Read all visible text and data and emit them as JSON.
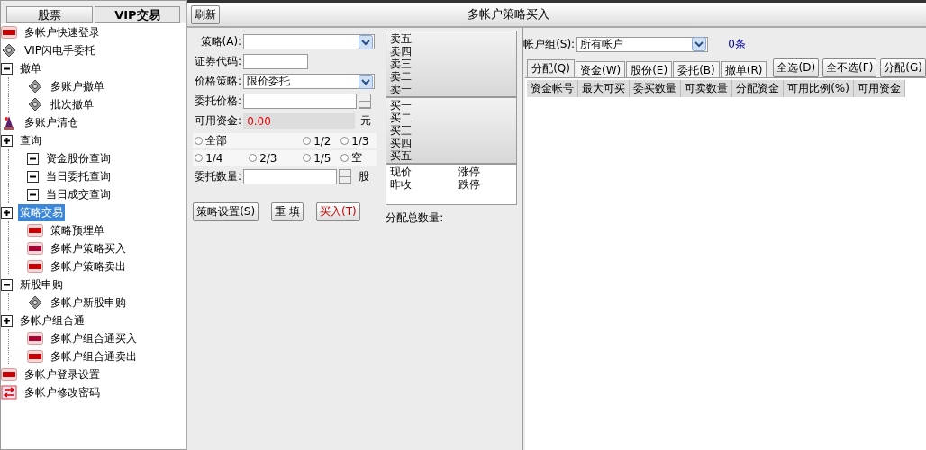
{
  "sidebar": {
    "tabs": [
      {
        "label": "股票",
        "selected": false
      },
      {
        "label": "VIP交易",
        "selected": true
      }
    ],
    "tree": [
      {
        "label": "多帐户快速登录",
        "kind": "sell",
        "selected": false
      },
      {
        "label": "VIP闪电手委托",
        "kind": "gear",
        "selected": false
      },
      {
        "label": "撤单",
        "kind": "minus",
        "selected": false,
        "children": [
          {
            "label": "多账户撤单",
            "kind": "gear",
            "selected": false
          },
          {
            "label": "批次撤单",
            "kind": "gear",
            "selected": false
          }
        ]
      },
      {
        "label": "多账户清仓",
        "kind": "wizard",
        "selected": false
      },
      {
        "label": "查询",
        "kind": "plus",
        "selected": false,
        "children": [
          {
            "label": "资金股份查询",
            "kind": "minus",
            "selected": false
          },
          {
            "label": "当日委托查询",
            "kind": "minus",
            "selected": false
          },
          {
            "label": "当日成交查询",
            "kind": "minus",
            "selected": false
          }
        ]
      },
      {
        "label": "策略交易",
        "kind": "plus",
        "selected": true,
        "children": [
          {
            "label": "策略预埋单",
            "kind": "sell",
            "selected": false
          },
          {
            "label": "多帐户策略买入",
            "kind": "buy",
            "selected": false
          },
          {
            "label": "多帐户策略卖出",
            "kind": "sell",
            "selected": false
          }
        ]
      },
      {
        "label": "新股申购",
        "kind": "minus",
        "selected": false,
        "children": [
          {
            "label": "多帐户新股申购",
            "kind": "gear",
            "selected": false
          }
        ]
      },
      {
        "label": "多帐户组合通",
        "kind": "plus",
        "selected": false,
        "children": [
          {
            "label": "多帐户组合通买入",
            "kind": "buy",
            "selected": false
          },
          {
            "label": "多帐户组合通卖出",
            "kind": "sell",
            "selected": false
          }
        ]
      },
      {
        "label": "多帐户登录设置",
        "kind": "sell",
        "selected": false
      },
      {
        "label": "多帐户修改密码",
        "kind": "swap",
        "selected": false
      }
    ]
  },
  "header": {
    "refresh_button": "刷新",
    "title": "多帐户策略买入"
  },
  "form": {
    "fields": [
      {
        "kind": "select",
        "label": "策略(A):"
      },
      {
        "kind": "text",
        "label": "证券代码:"
      },
      {
        "kind": "select",
        "label": "价格策略:",
        "value": "限价委托"
      },
      {
        "kind": "spin",
        "label": "委托价格:"
      },
      {
        "kind": "readonly",
        "label": "可用资金:",
        "value": "0.00",
        "unit": "元"
      }
    ],
    "ratios": [
      {
        "label": "全部",
        "checked": false
      },
      {
        "label": "1/2",
        "checked": false
      },
      {
        "label": "1/3",
        "checked": false
      },
      {
        "label": "1/4",
        "checked": false
      },
      {
        "label": "2/3",
        "checked": false
      },
      {
        "label": "1/5",
        "checked": false
      },
      {
        "label": "空",
        "checked": false
      }
    ],
    "quantity": {
      "label": "委托数量:",
      "unit": "股"
    },
    "buttons": [
      {
        "label": "策略设置(S)",
        "kind": "normal"
      },
      {
        "label": "重 填",
        "kind": "normal"
      },
      {
        "label": "买入(T)",
        "kind": "buy"
      }
    ]
  },
  "quote": {
    "asks": [
      "卖五",
      "卖四",
      "卖三",
      "卖二",
      "卖一"
    ],
    "bids": [
      "买一",
      "买二",
      "买三",
      "买四",
      "买五"
    ],
    "stats": [
      "现价",
      "涨停",
      "昨收",
      "跌停"
    ],
    "allocation_total_label": "分配总数量:"
  },
  "accounts": {
    "group_label": "帐户组(S):",
    "group_value": "所有帐户",
    "count": "0条",
    "tabs": [
      {
        "label": "分配(Q)",
        "selected": true
      },
      {
        "label": "资金(W)",
        "selected": false
      },
      {
        "label": "股份(E)",
        "selected": false
      },
      {
        "label": "委托(B)",
        "selected": false
      },
      {
        "label": "撤单(R)",
        "selected": false
      }
    ],
    "buttons": [
      "全选(D)",
      "全不选(F)",
      "分配(G)"
    ],
    "columns": [
      "资金帐号",
      "最大可买",
      "委买数量",
      "可卖数量",
      "分配资金",
      "可用比例(%)",
      "可用资金"
    ]
  }
}
